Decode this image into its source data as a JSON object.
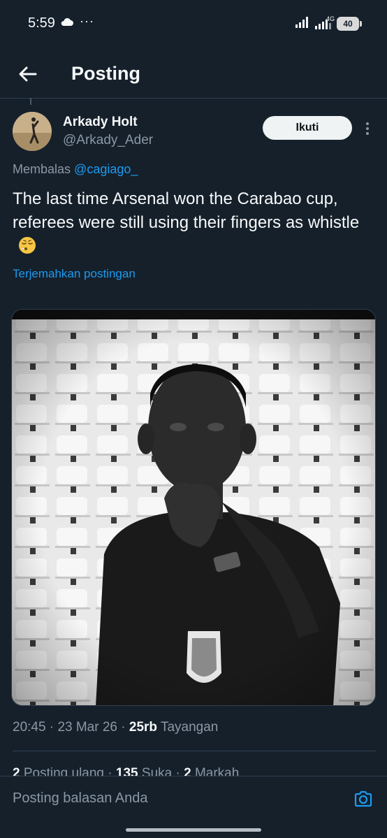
{
  "status_bar": {
    "time": "5:59",
    "dots": "···",
    "network": "4G",
    "battery": "40",
    "cloud_icon": "cloud-icon",
    "signal_icon": "signal-icon"
  },
  "header": {
    "title": "Posting",
    "back_icon": "arrow-left-icon"
  },
  "post": {
    "author": {
      "name": "Arkady Holt",
      "handle": "@Arkady_Ader"
    },
    "follow_label": "Ikuti",
    "more_icon": "more-vertical-icon",
    "reply_prefix": "Membalas",
    "reply_mention": "@cagiago_",
    "text": "The last time Arsenal won the Carabao cup, referees were still using their fingers as whistle",
    "emoji_icon": "exhaling-face-icon",
    "translate_label": "Terjemahkan postingan",
    "media_icon": "referee-photo",
    "time": "20:45",
    "date": "23 Mar 26",
    "views_count": "25rb",
    "views_label": "Tayangan",
    "sep": " · ",
    "stats": {
      "reposts_count": "2",
      "reposts_label": "Posting ulang",
      "likes_count": "135",
      "likes_label": "Suka",
      "bookmarks_count": "2",
      "bookmarks_label": "Markah"
    }
  },
  "reply_bar": {
    "placeholder": "Posting balasan Anda",
    "camera_icon": "camera-icon"
  },
  "colors": {
    "background": "#15202b",
    "accent": "#1d9bf0",
    "text_primary": "#f7f9f9",
    "text_secondary": "#8b98a5"
  }
}
